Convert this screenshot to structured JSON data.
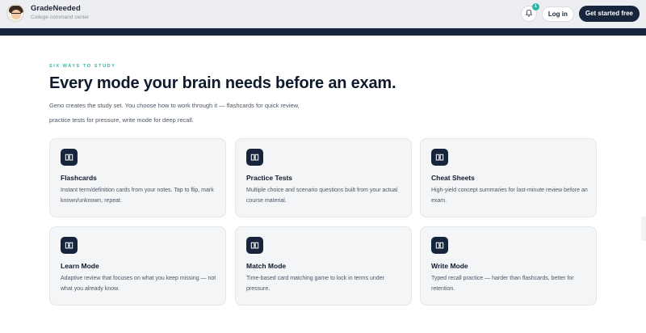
{
  "header": {
    "brand_name": "GradeNeeded",
    "brand_sub": "College command center",
    "notification_count": "1",
    "login_label": "Log in",
    "cta_label": "Get started free"
  },
  "hero": {
    "eyebrow": "SIX WAYS TO STUDY",
    "title": "Every mode your brain needs before an exam.",
    "lede_line1": "Geno creates the study set. You choose how to work through it — flashcards for quick review,",
    "lede_line2": "practice tests for pressure, write mode for deep recall."
  },
  "modes": [
    {
      "title": "Flashcards",
      "desc": "Instant term/definition cards from your notes. Tap to flip, mark known/unknown, repeat.",
      "icon": "book-icon"
    },
    {
      "title": "Practice Tests",
      "desc": "Multiple choice and scenario questions built from your actual course material.",
      "icon": "book-icon"
    },
    {
      "title": "Cheat Sheets",
      "desc": "High-yield concept summaries for last-minute review before an exam.",
      "icon": "book-icon"
    },
    {
      "title": "Learn Mode",
      "desc": "Adaptive review that focuses on what you keep missing — not what you already know.",
      "icon": "book-icon"
    },
    {
      "title": "Match Mode",
      "desc": "Time-based card matching game to lock in terms under pressure.",
      "icon": "book-icon"
    },
    {
      "title": "Write Mode",
      "desc": "Typed recall practice — harder than flashcards, better for retention.",
      "icon": "book-icon"
    }
  ],
  "colors": {
    "navy": "#16253c",
    "teal_accent": "#2fb7a0",
    "card_bg": "#f4f5f7"
  }
}
